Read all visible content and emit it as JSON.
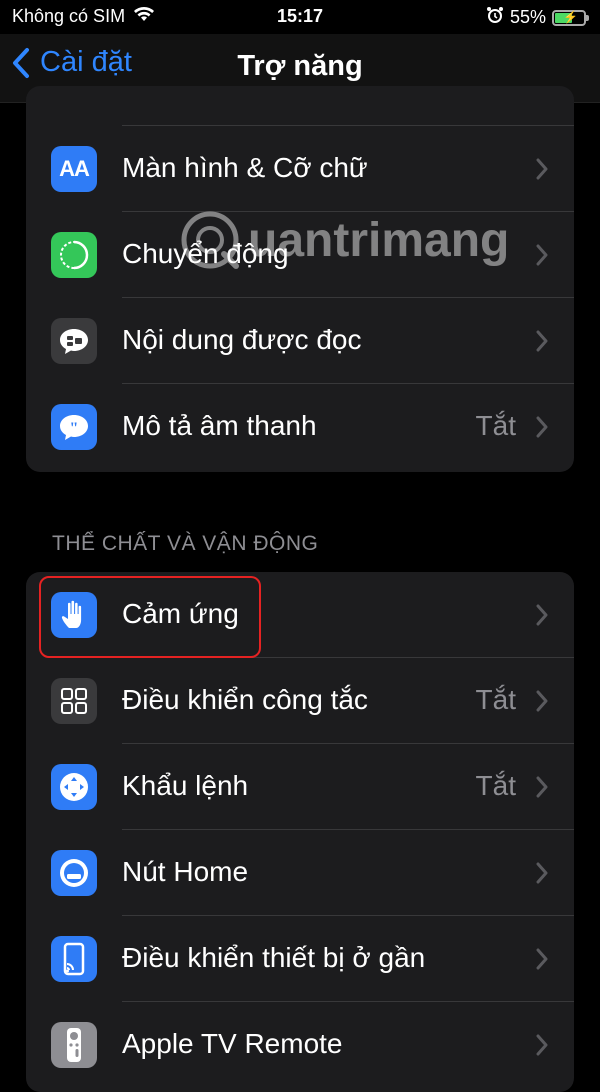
{
  "status_bar": {
    "carrier": "Không có SIM",
    "time": "15:17",
    "battery": "55%"
  },
  "nav": {
    "back_label": "Cài đặt",
    "title": "Trợ năng"
  },
  "group_top": [
    {
      "label": "Màn hình & Cỡ chữ",
      "value": "",
      "icon": "text-size-icon",
      "color": "#2f7cf6"
    },
    {
      "label": "Chuyển động",
      "value": "",
      "icon": "motion-icon",
      "color": "#34c759"
    },
    {
      "label": "Nội dung được đọc",
      "value": "",
      "icon": "spoken-content-icon",
      "color": "#3a3a3c"
    },
    {
      "label": "Mô tả âm thanh",
      "value": "Tắt",
      "icon": "audio-description-icon",
      "color": "#2f7cf6"
    }
  ],
  "section_physical": {
    "header": "THỂ CHẤT VÀ VẬN ĐỘNG",
    "items": [
      {
        "label": "Cảm ứng",
        "value": "",
        "icon": "touch-icon",
        "color": "#2f7cf6"
      },
      {
        "label": "Điều khiển công tắc",
        "value": "Tắt",
        "icon": "switch-control-icon",
        "color": "#3a3a3c"
      },
      {
        "label": "Khẩu lệnh",
        "value": "Tắt",
        "icon": "voice-control-icon",
        "color": "#2f7cf6"
      },
      {
        "label": "Nút Home",
        "value": "",
        "icon": "home-button-icon",
        "color": "#2f7cf6"
      },
      {
        "label": "Điều khiển thiết bị ở gần",
        "value": "",
        "icon": "nearby-devices-icon",
        "color": "#2f7cf6"
      },
      {
        "label": "Apple TV Remote",
        "value": "",
        "icon": "tv-remote-icon",
        "color": "#8e8e93"
      }
    ]
  },
  "watermark": "uantrimang"
}
